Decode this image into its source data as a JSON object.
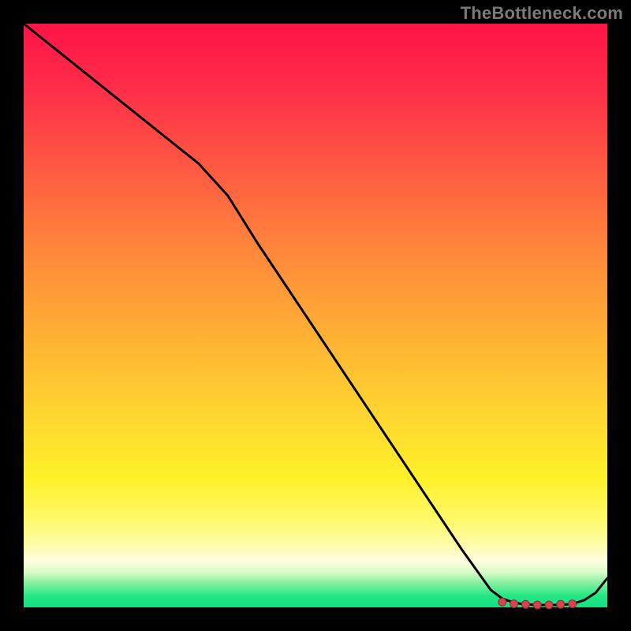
{
  "watermark": "TheBottleneck.com",
  "colors": {
    "page_bg": "#000000",
    "curve": "#000000",
    "dots_fill": "#d6444e",
    "dots_stroke": "#9a2430",
    "watermark": "#7a7a7a",
    "gradient_top": "#ff1446",
    "gradient_bottom": "#14df85"
  },
  "chart_data": {
    "type": "line",
    "title": "",
    "xlabel": "",
    "ylabel": "",
    "xlim": [
      0,
      100
    ],
    "ylim": [
      0,
      100
    ],
    "grid": false,
    "legend": false,
    "x": [
      0,
      5,
      10,
      15,
      20,
      25,
      30,
      35,
      40,
      45,
      50,
      55,
      60,
      65,
      70,
      75,
      80,
      82,
      84,
      86,
      88,
      90,
      92,
      94,
      96,
      98,
      100
    ],
    "values": [
      100,
      96,
      92,
      88,
      84,
      80,
      76,
      70.5,
      62.5,
      55,
      47.5,
      40,
      32.5,
      25,
      17.5,
      10,
      3,
      1.5,
      0.8,
      0.5,
      0.4,
      0.4,
      0.4,
      0.6,
      1.2,
      2.5,
      5
    ],
    "optimum_cluster_x": [
      82,
      84,
      86,
      88,
      90,
      92,
      94
    ],
    "optimum_cluster_y": [
      0.9,
      0.6,
      0.5,
      0.4,
      0.4,
      0.5,
      0.6
    ]
  }
}
